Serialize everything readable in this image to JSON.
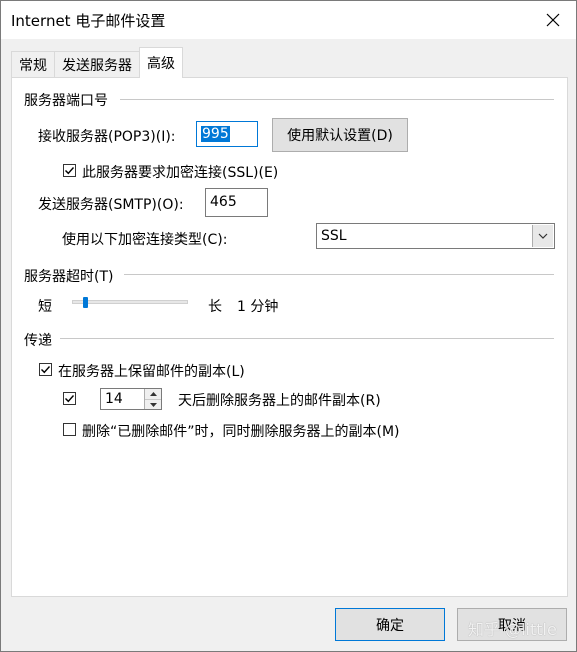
{
  "window": {
    "title": "Internet 电子邮件设置"
  },
  "tabs": [
    {
      "label": "常规"
    },
    {
      "label": "发送服务器"
    },
    {
      "label": "高级"
    }
  ],
  "ports": {
    "group_label": "服务器端口号",
    "incoming_label": "接收服务器(POP3)(I):",
    "incoming_value": "995",
    "default_button": "使用默认设置(D)",
    "ssl_checkbox_label": "此服务器要求加密连接(SSL)(E)",
    "ssl_checked": true,
    "outgoing_label": "发送服务器(SMTP)(O):",
    "outgoing_value": "465",
    "encryption_label": "使用以下加密连接类型(C):",
    "encryption_value": "SSL"
  },
  "timeout": {
    "group_label": "服务器超时(T)",
    "short_label": "短",
    "long_label": "长",
    "value_text": "1 分钟",
    "slider_fraction": 0.1
  },
  "delivery": {
    "group_label": "传递",
    "keep_copy_label": "在服务器上保留邮件的副本(L)",
    "keep_copy_checked": true,
    "remove_after_checked": true,
    "remove_after_days": "14",
    "remove_after_label": "天后删除服务器上的邮件副本(R)",
    "remove_deleted_label": "删除“已删除邮件”时，同时删除服务器上的副本(M)",
    "remove_deleted_checked": false
  },
  "footer": {
    "ok_label": "确定",
    "cancel_label": "取消"
  },
  "watermark": {
    "text": "知乎 @little"
  },
  "colors": {
    "accent": "#0078d7",
    "dialog_bg": "#f0f0f0",
    "panel_bg": "#ffffff"
  }
}
